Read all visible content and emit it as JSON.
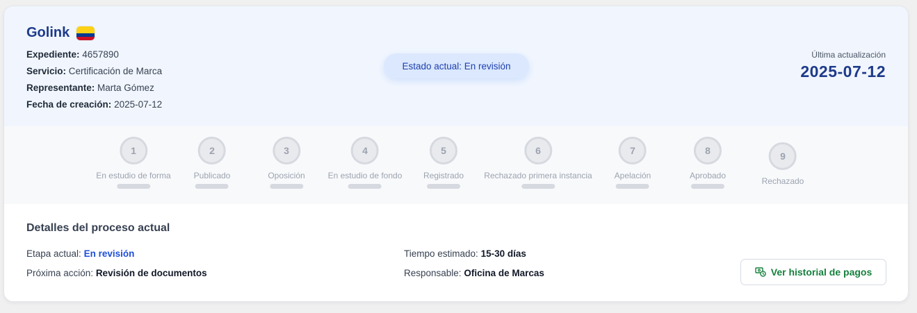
{
  "header": {
    "brand": "Golink",
    "flag": "colombia-flag-icon",
    "fields": [
      {
        "label": "Expediente:",
        "value": "4657890"
      },
      {
        "label": "Servicio:",
        "value": "Certificación de Marca"
      },
      {
        "label": "Representante:",
        "value": "Marta Gómez"
      },
      {
        "label": "Fecha de creación:",
        "value": "2025-07-12"
      }
    ],
    "status": "Estado actual: En revisión",
    "update_label": "Última actualización",
    "update_date": "2025-07-12"
  },
  "steps": [
    {
      "number": "1",
      "label": "En estudio de forma"
    },
    {
      "number": "2",
      "label": "Publicado"
    },
    {
      "number": "3",
      "label": "Oposición"
    },
    {
      "number": "4",
      "label": "En estudio de fondo"
    },
    {
      "number": "5",
      "label": "Registrado"
    },
    {
      "number": "6",
      "label": "Rechazado primera instancia"
    },
    {
      "number": "7",
      "label": "Apelación"
    },
    {
      "number": "8",
      "label": "Aprobado"
    },
    {
      "number": "9",
      "label": "Rechazado"
    }
  ],
  "details": {
    "title": "Detalles del proceso actual",
    "stage_label": "Etapa actual:",
    "stage_value": "En revisión",
    "next_label": "Próxima acción:",
    "next_value": "Revisión de documentos",
    "time_label": "Tiempo estimado:",
    "time_value": "15-30 días",
    "owner_label": "Responsable:",
    "owner_value": "Oficina de Marcas",
    "payments_button": "Ver historial de pagos",
    "payments_icon": "money-history-icon"
  },
  "colors": {
    "brand": "#1e3a8a",
    "accent": "#1d4ed8",
    "success": "#15803d",
    "header_bg": "#f1f6fe"
  }
}
